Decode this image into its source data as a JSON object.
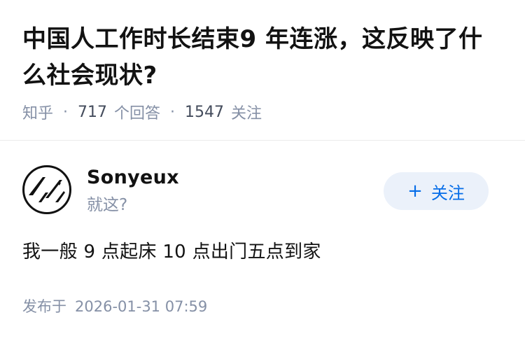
{
  "question": {
    "title": "中国人工作时长结束9 年连涨，这反映了什么社会现状?",
    "source": "知乎",
    "answer_count": "717",
    "answer_label": "个回答",
    "follow_count": "1547",
    "follow_label": "关注"
  },
  "author": {
    "name": "Sonyeux",
    "bio": "就这?",
    "avatar_icon": "stylized-li-logo-icon",
    "follow_button": {
      "icon": "plus-icon",
      "plus": "+",
      "label": "关注"
    }
  },
  "answer": {
    "text": "我一般 9 点起床 10 点出门五点到家",
    "publish_label": "发布于",
    "publish_time": "2026-01-31 07:59"
  },
  "colors": {
    "title": "#121212",
    "meta": "#8590a6",
    "accent": "#056de8",
    "button_bg": "#ebf1fa"
  }
}
